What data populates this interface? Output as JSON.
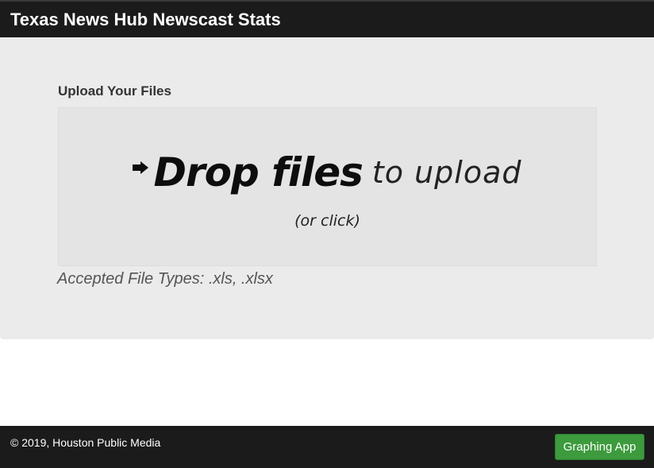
{
  "header": {
    "title": "Texas News Hub Newscast Stats"
  },
  "upload": {
    "heading": "Upload Your Files",
    "dropzone": {
      "arrow_icon": "arrow-right-icon",
      "strong_text": "Drop files",
      "light_text": "to upload",
      "sub_text": "(or click)"
    },
    "accepted_types": "Accepted File Types: .xls, .xlsx"
  },
  "footer": {
    "copyright": "© 2019, Houston Public Media",
    "graphing_button_label": "Graphing App",
    "graphing_button_color": "#3d9a3d"
  },
  "colors": {
    "header_bg": "#1b1b1b",
    "main_bg": "#ebebeb",
    "dropzone_bg": "#e4e4e4"
  }
}
